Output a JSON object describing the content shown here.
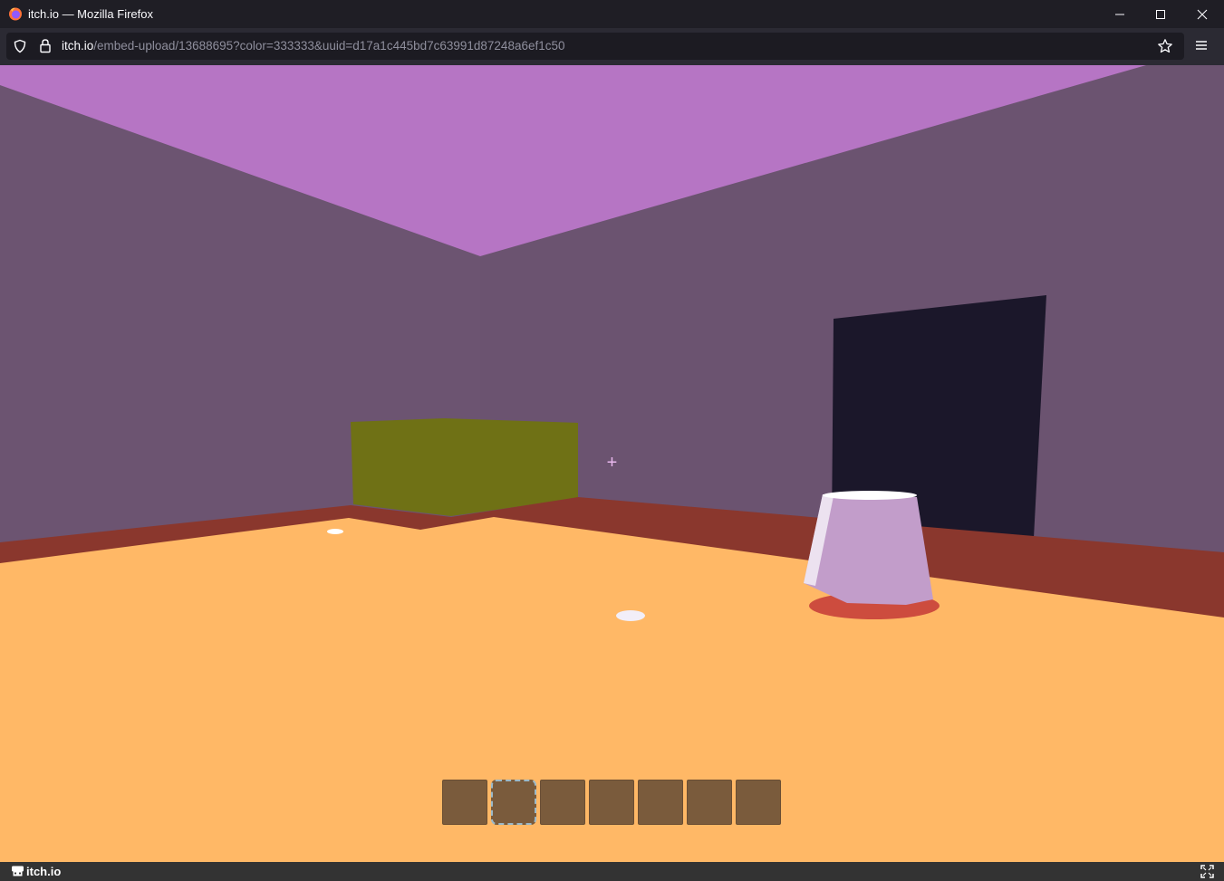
{
  "browser": {
    "window_title": "itch.io — Mozilla Firefox",
    "url_host": "itch.io",
    "url_path": "/embed-upload/13688695?color=333333&uuid=d17a1c445bd7c63991d87248a6ef1c50"
  },
  "game": {
    "crosshair": "+",
    "hotbar": {
      "slot_count": 7,
      "selected_slot": 2
    },
    "colors": {
      "ceiling": "#b675c4",
      "wall": "#6b5370",
      "floor": "#ffb866",
      "baseboard": "#8a372d",
      "green_block": "#6f7115",
      "dark_doorway": "#1b172a",
      "cup": "#c29dca",
      "slot": "#7a5b3c"
    }
  },
  "footer": {
    "brand": "itch.io"
  }
}
